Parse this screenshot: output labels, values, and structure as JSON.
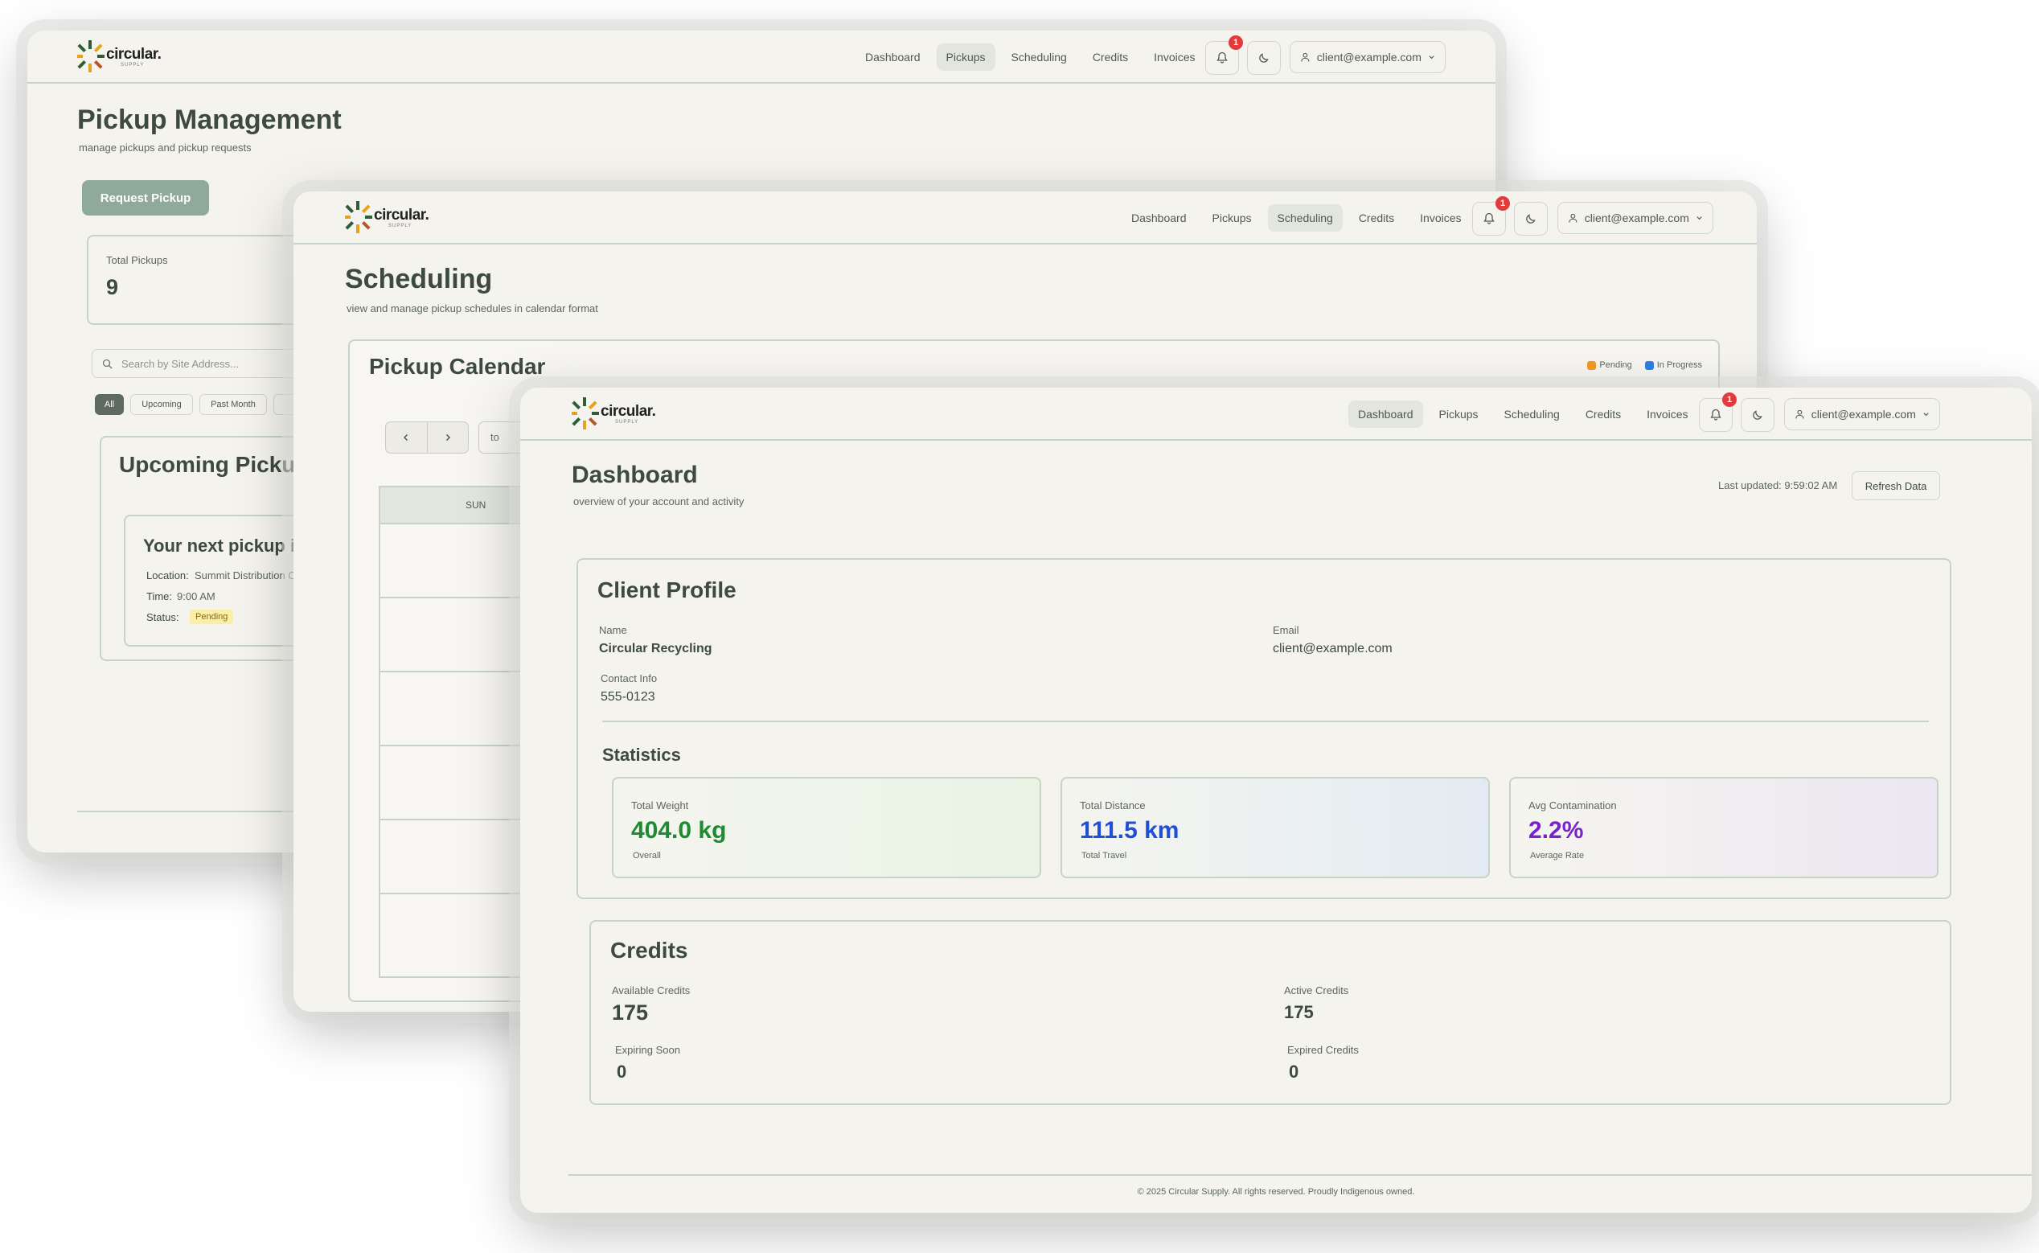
{
  "brand": {
    "name": "circular.",
    "sub": "SUPPLY"
  },
  "nav": {
    "links": [
      "Dashboard",
      "Pickups",
      "Scheduling",
      "Credits",
      "Invoices"
    ],
    "notif_count": "1",
    "user_email": "client@example.com"
  },
  "pickups": {
    "title": "Pickup Management",
    "subtitle": "manage pickups and pickup requests",
    "request_button": "Request Pickup",
    "total_label": "Total Pickups",
    "total_value": "9",
    "search_placeholder": "Search by Site Address...",
    "filters": [
      "All",
      "Upcoming",
      "Past Month"
    ],
    "upcoming_title": "Upcoming Picku",
    "next_title": "Your next pickup i",
    "location_label": "Location:",
    "location_value": "Summit Distribution C",
    "time_label": "Time:",
    "time_value": "9:00 AM",
    "status_label": "Status:",
    "status_value": "Pending"
  },
  "scheduling": {
    "title": "Scheduling",
    "subtitle": "view and manage pickup schedules in calendar format",
    "calendar_title": "Pickup Calendar",
    "legend": [
      {
        "label": "Pending",
        "color": "#f29b1d"
      },
      {
        "label": "In Progress",
        "color": "#2f7fe6"
      }
    ],
    "today_btn": "to",
    "day_header": "SUN"
  },
  "dashboard": {
    "title": "Dashboard",
    "subtitle": "overview of your account and activity",
    "last_updated": "Last updated: 9:59:02 AM",
    "refresh_button": "Refresh Data",
    "profile": {
      "title": "Client Profile",
      "name_label": "Name",
      "name_value": "Circular Recycling",
      "email_label": "Email",
      "email_value": "client@example.com",
      "contact_label": "Contact Info",
      "contact_value": "555-0123"
    },
    "statistics": {
      "title": "Statistics",
      "cards": [
        {
          "label": "Total Weight",
          "value": "404.0 kg",
          "sub": "Overall",
          "color": "#1e8a34"
        },
        {
          "label": "Total Distance",
          "value": "111.5 km",
          "sub": "Total Travel",
          "color": "#1f4fd6"
        },
        {
          "label": "Avg Contamination",
          "value": "2.2%",
          "sub": "Average Rate",
          "color": "#7a22c9"
        }
      ]
    },
    "credits": {
      "title": "Credits",
      "available_label": "Available Credits",
      "available_value": "175",
      "active_label": "Active Credits",
      "active_value": "175",
      "expiring_label": "Expiring Soon",
      "expiring_value": "0",
      "expired_label": "Expired Credits",
      "expired_value": "0"
    },
    "footer": "© 2025 Circular Supply. All rights reserved. Proudly Indigenous owned."
  }
}
